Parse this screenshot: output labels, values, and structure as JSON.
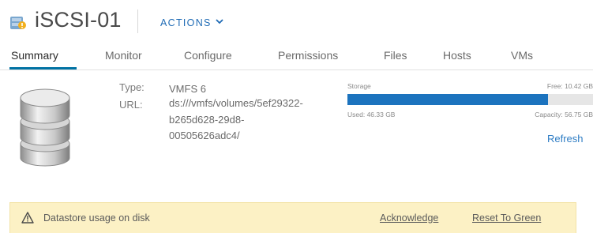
{
  "header": {
    "title": "iSCSI-01",
    "actions_label": "ACTIONS"
  },
  "tabs": [
    {
      "label": "Summary",
      "active": true
    },
    {
      "label": "Monitor"
    },
    {
      "label": "Configure"
    },
    {
      "label": "Permissions"
    },
    {
      "label": "Files"
    },
    {
      "label": "Hosts"
    },
    {
      "label": "VMs"
    }
  ],
  "details": {
    "type_label": "Type:",
    "type_value": "VMFS 6",
    "url_label": "URL:",
    "url_lines": [
      "ds:///vmfs/volumes/5ef29322-",
      "b265d628-29d8-",
      "00505626adc4/"
    ]
  },
  "storage": {
    "label": "Storage",
    "free": "Free: 10.42 GB",
    "used": "Used: 46.33 GB",
    "capacity": "Capacity: 56.75 GB",
    "used_fraction": 0.816,
    "refresh_label": "Refresh"
  },
  "alert": {
    "text": "Datastore usage on disk",
    "acknowledge_label": "Acknowledge",
    "reset_label": "Reset To Green"
  },
  "icons": {
    "datastore": "datastore-icon",
    "database": "database-icon",
    "chevron": "chevron-down-icon",
    "warning": "warning-icon"
  },
  "colors": {
    "accent": "#1f6bb5",
    "tab_underline": "#0072a3",
    "bar_fill": "#1c73be",
    "alert_bg": "#fcf1c5"
  }
}
